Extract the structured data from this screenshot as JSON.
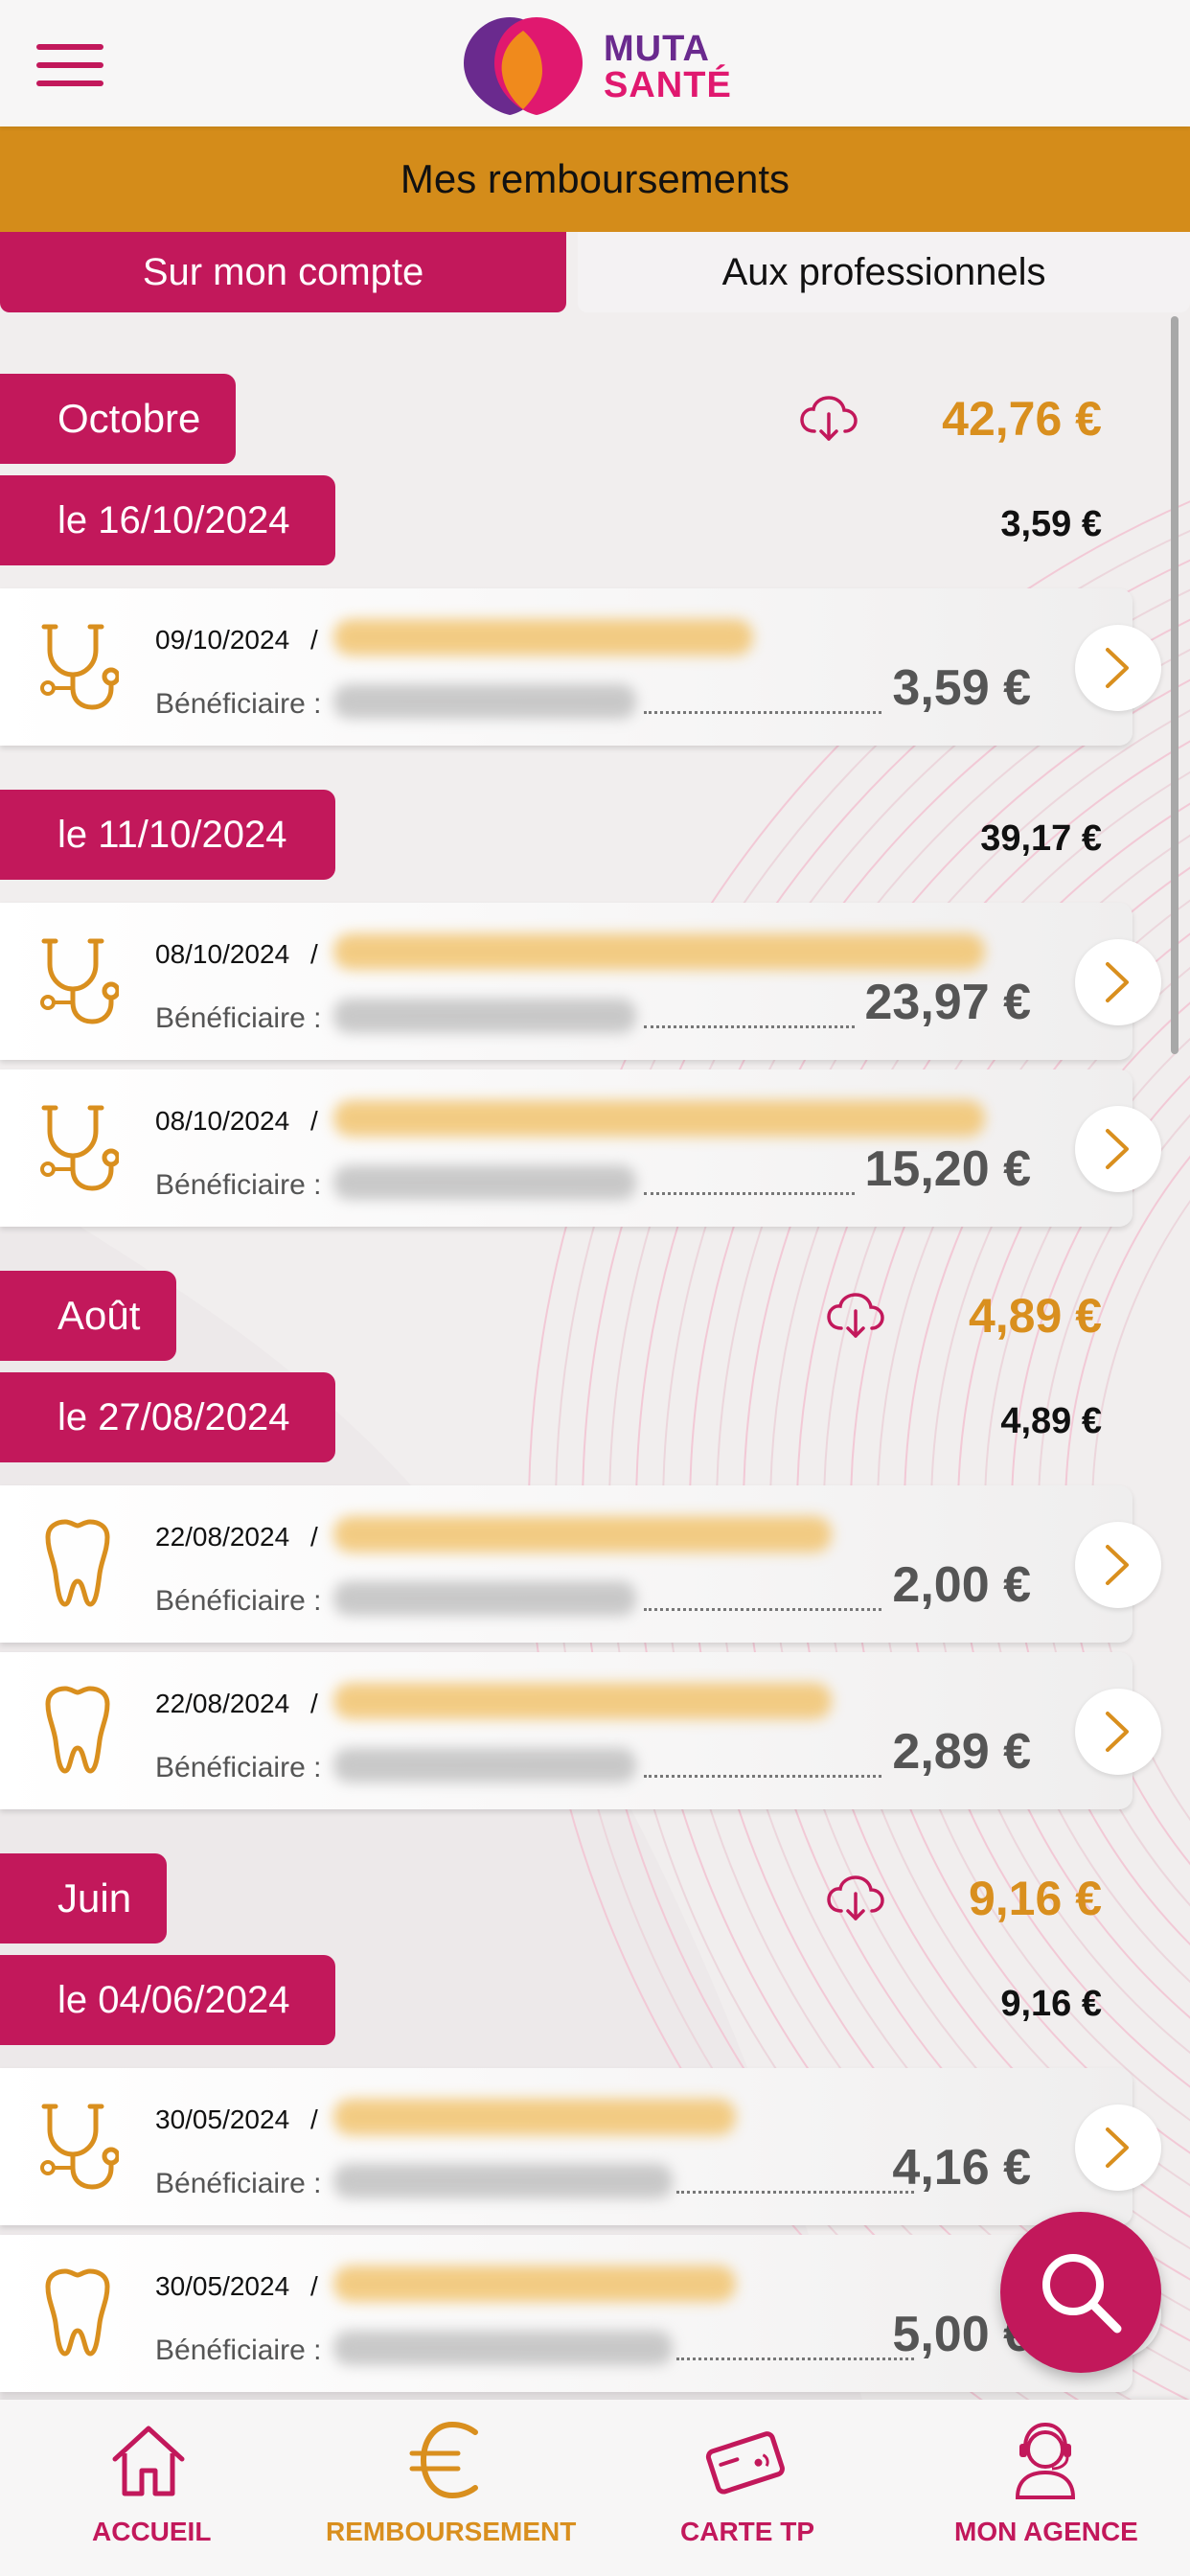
{
  "header": {
    "logo_line1": "MUTA",
    "logo_line2": "SANTÉ"
  },
  "title": "Mes remboursements",
  "tabs": [
    {
      "label": "Sur mon compte",
      "active": true
    },
    {
      "label": "Aux professionnels",
      "active": false
    }
  ],
  "labels": {
    "beneficiaire": "Bénéficiaire :"
  },
  "months": [
    {
      "name": "Octobre",
      "total": "42,76 €",
      "groups": [
        {
          "date": "le 16/10/2024",
          "total": "3,59 €",
          "items": [
            {
              "icon": "stethoscope-icon",
              "date": "09/10/2024",
              "amount": "3,59 €"
            }
          ]
        },
        {
          "date": "le 11/10/2024",
          "total": "39,17 €",
          "items": [
            {
              "icon": "stethoscope-icon",
              "date": "08/10/2024",
              "amount": "23,97 €"
            },
            {
              "icon": "stethoscope-icon",
              "date": "08/10/2024",
              "amount": "15,20 €"
            }
          ]
        }
      ]
    },
    {
      "name": "Août",
      "total": "4,89 €",
      "groups": [
        {
          "date": "le 27/08/2024",
          "total": "4,89 €",
          "items": [
            {
              "icon": "tooth-icon",
              "date": "22/08/2024",
              "amount": "2,00 €"
            },
            {
              "icon": "tooth-icon",
              "date": "22/08/2024",
              "amount": "2,89 €"
            }
          ]
        }
      ]
    },
    {
      "name": "Juin",
      "total": "9,16 €",
      "groups": [
        {
          "date": "le 04/06/2024",
          "total": "9,16 €",
          "items": [
            {
              "icon": "stethoscope-icon",
              "date": "30/05/2024",
              "amount": "4,16 €"
            },
            {
              "icon": "tooth-icon",
              "date": "30/05/2024",
              "amount": "5,00 €"
            }
          ]
        }
      ]
    }
  ],
  "bottom_nav": [
    {
      "label": "ACCUEIL",
      "icon": "home-icon"
    },
    {
      "label": "REMBOURSEMENT",
      "icon": "euro-icon",
      "active": true
    },
    {
      "label": "CARTE TP",
      "icon": "card-icon"
    },
    {
      "label": "MON AGENCE",
      "icon": "agent-icon"
    }
  ],
  "colors": {
    "brand_pink": "#c2185b",
    "brand_orange": "#d48c1a",
    "amount_orange": "#d98f1e",
    "logo_purple": "#6a2a8e"
  }
}
